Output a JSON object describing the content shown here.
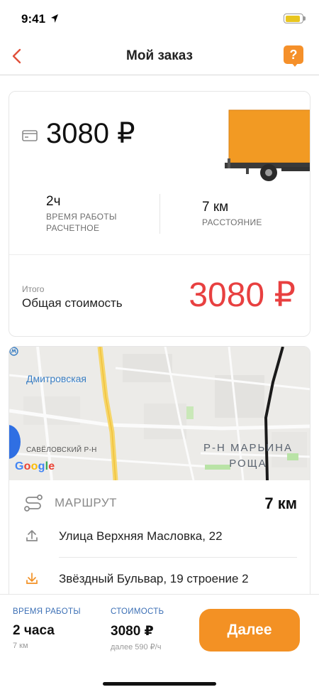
{
  "status_bar": {
    "time": "9:41"
  },
  "nav": {
    "title": "Мой заказ",
    "help_label": "?"
  },
  "summary": {
    "price": "3080 ₽",
    "work_time_value": "2ч",
    "work_time_label": "ВРЕМЯ РАБОТЫ РАСЧЕТНОЕ",
    "distance_value": "7 км",
    "distance_label": "РАССТОЯНИЕ",
    "total_caption": "Итого",
    "total_label": "Общая стоимость",
    "total_value": "3080 ₽"
  },
  "map": {
    "metro_station": "Дмитровская",
    "district_left": "САВЁЛОВСКИЙ Р-Н",
    "district_right_line1": "Р-Н МАРЬИНА",
    "district_right_line2": "РОЩА",
    "google_letters": [
      "G",
      "o",
      "o",
      "g",
      "l",
      "e"
    ]
  },
  "route": {
    "title": "МАРШРУТ",
    "distance": "7 км",
    "stops": [
      {
        "icon": "upload-icon",
        "address": "Улица Верхняя Масловка, 22"
      },
      {
        "icon": "download-icon",
        "address": "Звёздный Бульвар, 19 строение 2"
      }
    ]
  },
  "bottom": {
    "work_time_label": "ВРЕМЯ РАБОТЫ",
    "work_time_value": "2 часа",
    "work_time_sub": "7 км",
    "cost_label": "СТОИМОСТЬ",
    "cost_value": "3080 ₽",
    "cost_sub": "далее 590 ₽/ч",
    "next_button": "Далее"
  },
  "colors": {
    "accent_orange": "#f39124",
    "price_red": "#e84040",
    "label_blue": "#3b6fb5",
    "metro_blue": "#3b7fc4"
  }
}
